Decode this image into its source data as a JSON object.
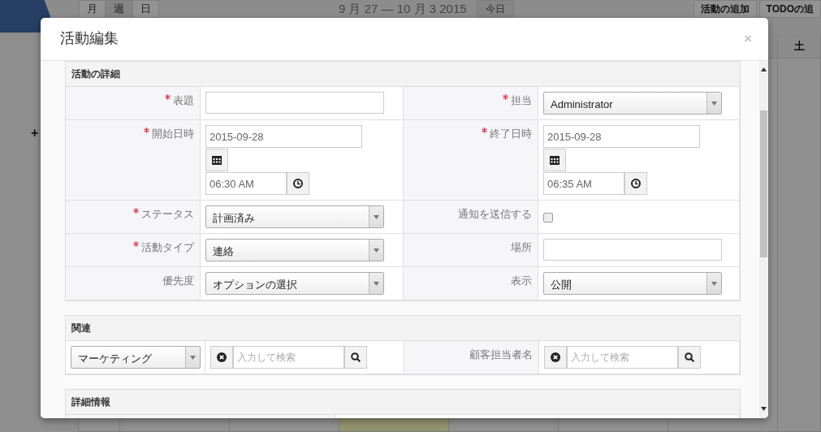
{
  "calendar": {
    "views": [
      {
        "label": "月",
        "selected": false
      },
      {
        "label": "週",
        "selected": true
      },
      {
        "label": "日",
        "selected": false
      }
    ],
    "date_range": "9 月 27 — 10 月 3 2015",
    "today_button": {
      "label": "今日",
      "disabled": true
    },
    "actions": [
      "活動の追加",
      "TODOの追"
    ],
    "day_header": "土",
    "sidebar_add": "+"
  },
  "modal": {
    "title": "活動編集",
    "close": "×",
    "details": {
      "title": "活動の詳細",
      "rows": [
        [
          {
            "label": "表題",
            "required": true,
            "kind": "text"
          },
          {
            "label": "担当",
            "required": true,
            "kind": "select",
            "value": "Administrator"
          }
        ],
        [
          {
            "label": "開始日時",
            "required": true,
            "kind": "datetime",
            "date": "2015-09-28",
            "time": "06:30 AM"
          },
          {
            "label": "終了日時",
            "required": true,
            "kind": "datetime",
            "date": "2015-09-28",
            "time": "06:35 AM"
          }
        ],
        [
          {
            "label": "ステータス",
            "required": true,
            "kind": "select",
            "value": "計画済み"
          },
          {
            "label": "通知を送信する",
            "required": false,
            "kind": "checkbox",
            "checked": false
          }
        ],
        [
          {
            "label": "活動タイプ",
            "required": true,
            "kind": "select",
            "value": "連絡"
          },
          {
            "label": "場所",
            "required": false,
            "kind": "text"
          }
        ],
        [
          {
            "label": "優先度",
            "required": false,
            "kind": "select",
            "value": "オプションの選択"
          },
          {
            "label": "表示",
            "required": false,
            "kind": "select",
            "value": "公開"
          }
        ]
      ]
    },
    "related": {
      "title": "関連",
      "parent_type": "マーケティング",
      "parent_search": {
        "placeholder": "入力して検索"
      },
      "contact": {
        "label": "顧客担当者名",
        "placeholder": "入力して検索"
      }
    },
    "more": {
      "title": "詳細情報"
    }
  }
}
